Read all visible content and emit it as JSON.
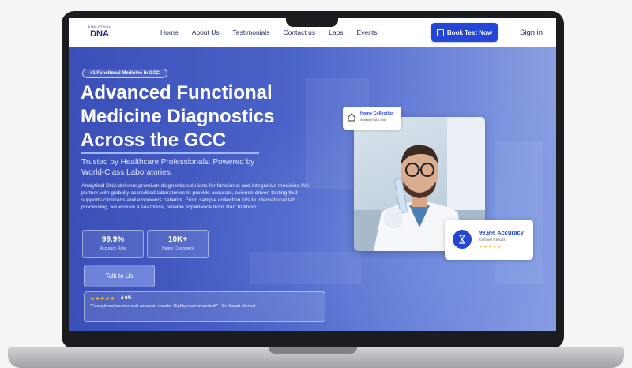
{
  "nav": {
    "brand_top": "ANALYTIKAL",
    "brand_main": "DNA",
    "links": [
      "Home",
      "About Us",
      "Testimonials",
      "Contact us",
      "Labs",
      "Events"
    ],
    "book_label": "Book Test Now",
    "signin_label": "Sign in"
  },
  "hero": {
    "badge": "#1 Functional Medicine In GCC",
    "title": "Advanced Functional Medicine Diagnostics Across the GCC",
    "subtitle": "Trusted by Healthcare Professionals. Powered by World-Class Laboratories.",
    "description": "Analytikal DNA delivers premium diagnostic solutions for functional and integrative medicine.We partner with globally accredited laboratories to provide accurate, science-driven testing that supports clinicians and empowers patients. From sample collection kits to international lab processing, we ensure a seamless, reliable experience from start to finish.",
    "stats": [
      {
        "value": "99.9%",
        "label": "Accuracy Rate"
      },
      {
        "value": "10K+",
        "label": "Happy Customers"
      }
    ],
    "cta_label": "Talk to Us",
    "review": {
      "stars": "★★★★★",
      "rating": "4.9/5",
      "quote": "\"Exceptional service and accurate results. Highly recommended!\" - Dr. Sarah Ahmed"
    }
  },
  "cards": {
    "home_title": "Home Collection",
    "home_sub": "Available UAE-wide",
    "acc_title": "99.9% Accuracy",
    "acc_sub": "Certified Results",
    "acc_stars": "★★★★★"
  },
  "colors": {
    "accent": "#2346d8",
    "hero_start": "#3a4fb8",
    "hero_end": "#8b9fe0",
    "star": "#ffc233"
  }
}
